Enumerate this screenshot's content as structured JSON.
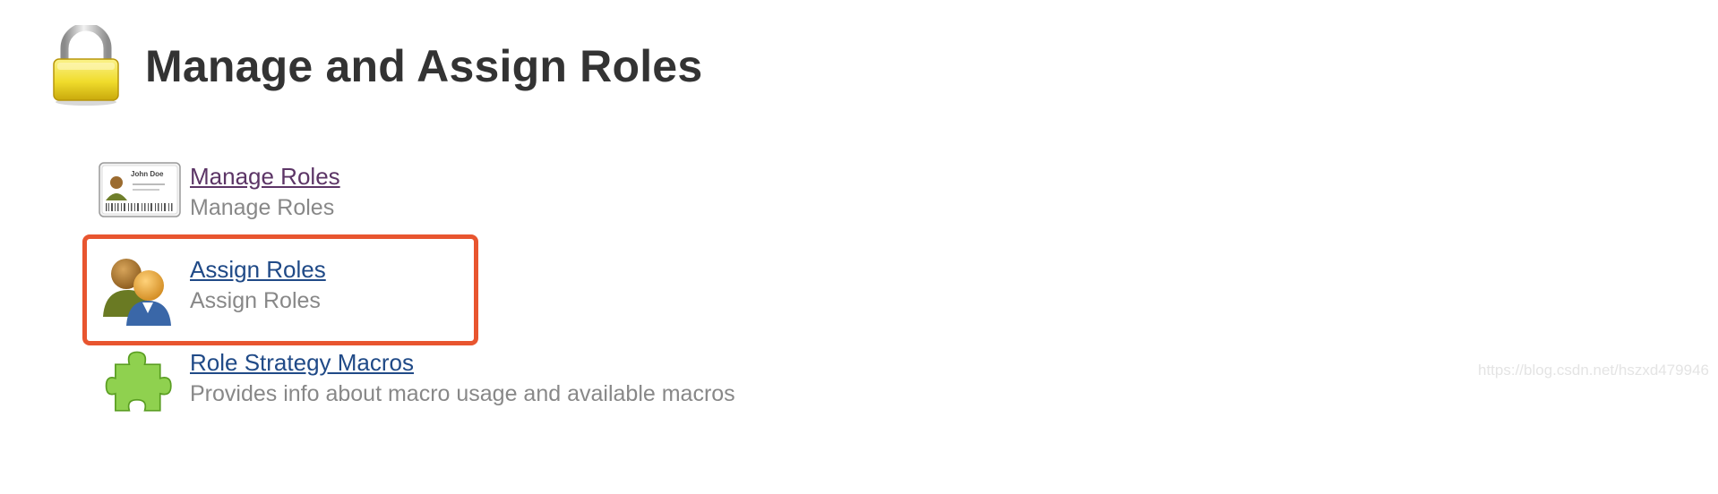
{
  "page": {
    "title": "Manage and Assign Roles"
  },
  "items": [
    {
      "label": "Manage Roles",
      "description": "Manage Roles",
      "icon": "id-card-icon"
    },
    {
      "label": "Assign Roles",
      "description": "Assign Roles",
      "icon": "users-icon"
    },
    {
      "label": "Role Strategy Macros",
      "description": "Provides info about macro usage and available macros",
      "icon": "puzzle-piece-icon"
    }
  ],
  "highlight": {
    "color": "#e8552f",
    "target": "Assign Roles"
  },
  "colors": {
    "visited_link": "#5c3566",
    "link": "#204a87",
    "description": "#888888",
    "title": "#333333"
  },
  "watermark": "https://blog.csdn.net/hszxd479946"
}
